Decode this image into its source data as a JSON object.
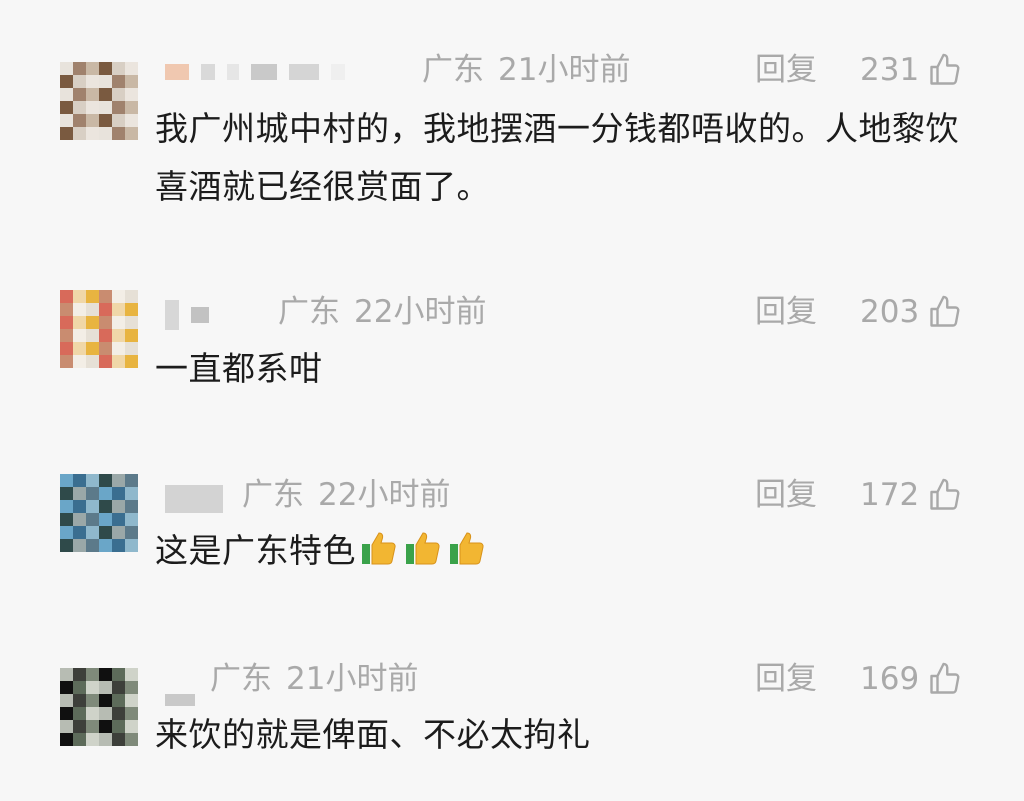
{
  "comments": [
    {
      "location": "广东",
      "time": "21小时前",
      "reply_label": "回复",
      "likes": "231",
      "text": "我广州城中村的，我地摆酒一分钱都唔收的。人地黎饮喜酒就已经很赏面了。",
      "avatar_colors": [
        "#e8e3dc",
        "#a0826d",
        "#c9b8a5",
        "#7a5a40",
        "#d8cfc4",
        "#ebe5de"
      ]
    },
    {
      "location": "广东",
      "time": "22小时前",
      "reply_label": "回复",
      "likes": "203",
      "text": "一直都系咁",
      "avatar_colors": [
        "#d86a5a",
        "#f0d7a8",
        "#e8b440",
        "#c98c70",
        "#f3eee6",
        "#e6e0d6"
      ]
    },
    {
      "location": "广东",
      "time": "22小时前",
      "reply_label": "回复",
      "likes": "172",
      "text": "这是广东特色",
      "emoji": [
        "thumbs-up",
        "thumbs-up",
        "thumbs-up"
      ],
      "avatar_colors": [
        "#6aa6c8",
        "#3a6e90",
        "#8fb8cc",
        "#2f4a4a",
        "#9aa8a8",
        "#5c7a8a"
      ]
    },
    {
      "location": "广东",
      "time": "21小时前",
      "reply_label": "回复",
      "likes": "169",
      "text": "来饮的就是俾面、不必太拘礼",
      "avatar_colors": [
        "#b7bcb3",
        "#3d3f3a",
        "#7f8a7a",
        "#101010",
        "#5d6b5a",
        "#cfd3c9"
      ]
    }
  ],
  "icons": {
    "like": "thumbs-up-outline-icon",
    "emoji": "thumbs-up-emoji-icon"
  }
}
